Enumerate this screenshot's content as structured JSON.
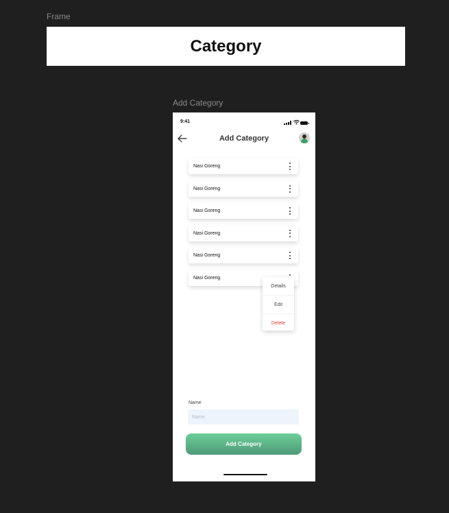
{
  "canvas": {
    "frame_label": "Frame",
    "frame_title": "Category",
    "screen_label": "Add Category"
  },
  "status_bar": {
    "time": "9:41"
  },
  "header": {
    "title": "Add Category",
    "back_icon": "arrow-left-icon",
    "avatar_icon": "user-avatar"
  },
  "categories": [
    {
      "label": "Nasi Goreng"
    },
    {
      "label": "Nasi Goreng"
    },
    {
      "label": "Nasi Goreng"
    },
    {
      "label": "Nasi Goreng"
    },
    {
      "label": "Nasi Goreng"
    },
    {
      "label": "Nasi Goreng"
    }
  ],
  "context_menu": {
    "details": "Details",
    "edit": "Edit",
    "delete": "Delete",
    "delete_color": "#e53935"
  },
  "form": {
    "name_label": "Name",
    "name_placeholder": "Name",
    "name_value": "",
    "submit_label": "Add Category"
  },
  "colors": {
    "canvas_bg": "#1f1f1f",
    "button_gradient_top": "#6ccf97",
    "button_gradient_bottom": "#4f9a7a",
    "input_bg": "#eef4fc"
  }
}
